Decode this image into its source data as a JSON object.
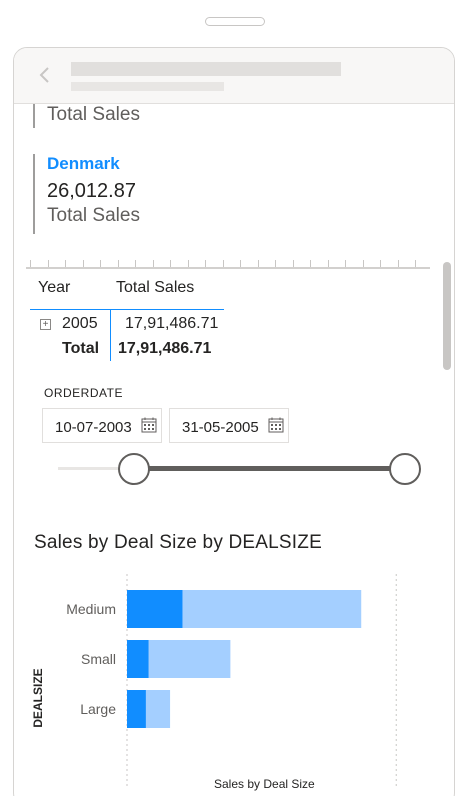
{
  "cards": [
    {
      "label": "Total Sales"
    },
    {
      "title": "Denmark",
      "value": "26,012.87",
      "label": "Total Sales"
    }
  ],
  "matrix": {
    "headers": [
      "Year",
      "Total Sales"
    ],
    "rows": [
      {
        "year": "2005",
        "value": "17,91,486.71"
      }
    ],
    "total_label": "Total",
    "total_value": "17,91,486.71",
    "expand_symbol": "+"
  },
  "slicer": {
    "title": "ORDERDATE",
    "start_date": "10-07-2003",
    "end_date": "31-05-2005",
    "range_fraction": [
      0.2,
      1.0
    ]
  },
  "chart_data": {
    "type": "bar",
    "title": "Sales by Deal Size by DEALSIZE",
    "xlabel": "Sales by Deal Size",
    "ylabel": "DEALSIZE",
    "categories": [
      "Medium",
      "Small",
      "Large"
    ],
    "series": [
      {
        "values": [
          1.03,
          0.4,
          0.35
        ]
      },
      {
        "values": [
          4.35,
          1.92,
          0.8
        ]
      }
    ],
    "xlim": [
      0,
      5.2
    ],
    "xticks": [
      "0M",
      "5M"
    ],
    "grid": true,
    "colors": [
      "#118dff",
      "#a4cfff"
    ]
  },
  "icons": {
    "back": "chevron-left-icon",
    "calendar": "calendar-icon"
  }
}
